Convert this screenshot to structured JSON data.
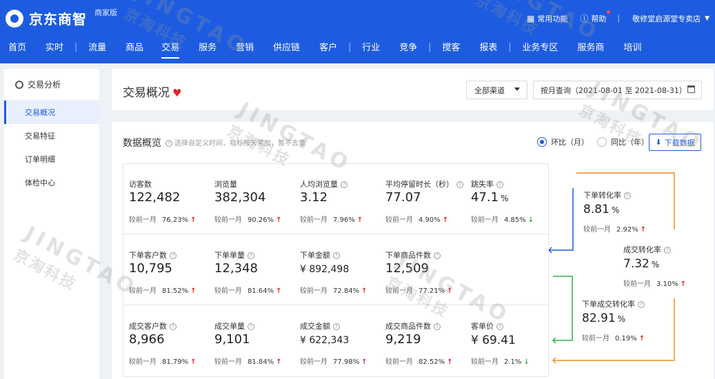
{
  "header": {
    "brand": "京东商智",
    "badge": "商家版",
    "quick_functions": "常用功能",
    "help": "帮助",
    "divider": "|",
    "shop_name": "敬修堂启源堂专卖店"
  },
  "nav": [
    {
      "label": "首页"
    },
    {
      "label": "实时"
    },
    {
      "label": "流量"
    },
    {
      "label": "商品"
    },
    {
      "label": "交易"
    },
    {
      "label": "服务"
    },
    {
      "label": "营销"
    },
    {
      "label": "供应链"
    },
    {
      "label": "客户"
    },
    {
      "label": "行业"
    },
    {
      "label": "竞争"
    },
    {
      "label": "搅客"
    },
    {
      "label": "报表"
    },
    {
      "label": "业务专区"
    },
    {
      "label": "服务商"
    },
    {
      "label": "培训"
    }
  ],
  "nav_divider": "|",
  "sidebar": {
    "section_title": "交易分析",
    "items": [
      {
        "label": "交易概况"
      },
      {
        "label": "交易特征"
      },
      {
        "label": "订单明细"
      },
      {
        "label": "体检中心"
      }
    ]
  },
  "title_bar": {
    "title": "交易概况",
    "heart": "♥",
    "channel": "全部渠道",
    "date_range": "按月查询（2021-08-01 至 2021-08-31）"
  },
  "overview": {
    "title": "数据概览",
    "note": "选择自定义时间，指标按天累加，暂不去重",
    "radio_mom": "环比（月）",
    "radio_yoy": "同比（年）",
    "download": "下载数据"
  },
  "compare_label": "较前一月",
  "rows": [
    [
      {
        "label": "访客数",
        "value": "122,482",
        "pct": "76.23%",
        "dir": "↑",
        "help": false
      },
      {
        "label": "浏览量",
        "value": "382,304",
        "pct": "90.26%",
        "dir": "↑",
        "help": false
      },
      {
        "label": "人均浏览量",
        "value": "3.12",
        "pct": "7.96%",
        "dir": "↑",
        "help": true
      },
      {
        "label": "平均停留时长（秒）",
        "value": "77.07",
        "pct": "4.90%",
        "dir": "↑",
        "help": true
      },
      {
        "label": "跳失率",
        "value": "47.1",
        "unit": "%",
        "pct": "4.85%",
        "dir": "↓",
        "help": true
      }
    ],
    [
      {
        "label": "下单客户数",
        "value": "10,795",
        "pct": "81.52%",
        "dir": "↑",
        "help": true
      },
      {
        "label": "下单单量",
        "value": "12,348",
        "pct": "81.64%",
        "dir": "↑",
        "help": true
      },
      {
        "label": "下单金额",
        "value": "¥ 892,498",
        "pct": "72.84%",
        "dir": "↑",
        "help": true
      },
      {
        "label": "下单商品件数",
        "value": "12,509",
        "pct": "77.21%",
        "dir": "↑",
        "help": true
      }
    ],
    [
      {
        "label": "成交客户数",
        "value": "8,966",
        "pct": "81.79%",
        "dir": "↑",
        "help": true
      },
      {
        "label": "成交单量",
        "value": "9,101",
        "pct": "81.84%",
        "dir": "↑",
        "help": true
      },
      {
        "label": "成交金额",
        "value": "¥ 622,343",
        "pct": "77.98%",
        "dir": "↑",
        "help": true
      },
      {
        "label": "成交商品件数",
        "value": "9,219",
        "pct": "82.52%",
        "dir": "↑",
        "help": true
      },
      {
        "label": "客单价",
        "value": "¥ 69.41",
        "pct": "2.1%",
        "dir": "↓",
        "help": true
      }
    ]
  ],
  "funnel": [
    {
      "label": "下单转化率",
      "value": "8.81",
      "unit": "%",
      "pct": "2.92%",
      "dir": "↑"
    },
    {
      "label": "成交转化率",
      "value": "7.32",
      "unit": "%",
      "pct": "3.10%",
      "dir": "↑"
    },
    {
      "label": "下单成交转化率",
      "value": "82.91",
      "unit": "%",
      "pct": "0.19%",
      "dir": "↑"
    }
  ],
  "watermark": {
    "en": "JINGTAO",
    "cn": "京淘科技"
  },
  "colors": {
    "brand": "#1d5ce0",
    "up": "#e4252d",
    "down": "#2db04b",
    "blue_line": "#1d5ce0",
    "green_line": "#2db04b",
    "orange_line": "#f08a24"
  }
}
